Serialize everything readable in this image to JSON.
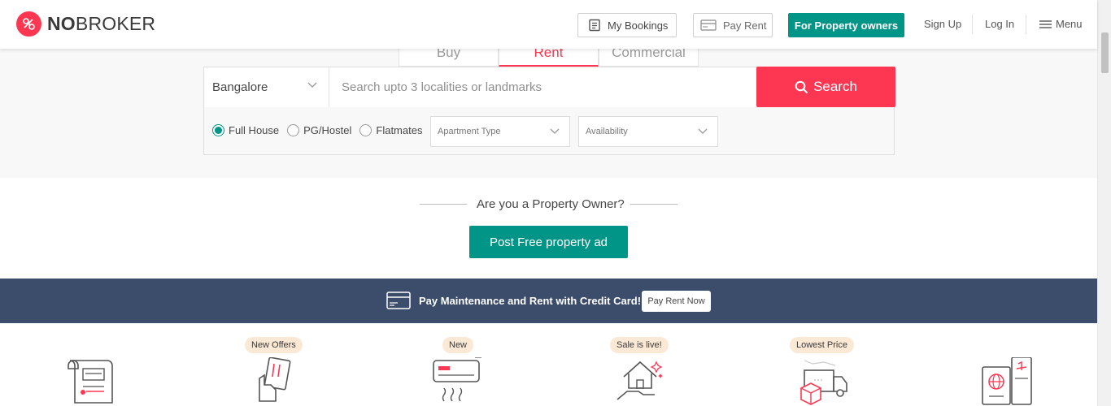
{
  "brand": {
    "name_bold": "NO",
    "name_rest": "BROKER",
    "accent_color": "#fd3752",
    "teal_color": "#009587"
  },
  "header": {
    "my_bookings": "My Bookings",
    "pay_rent": "Pay Rent",
    "for_owners": "For Property owners",
    "sign_up": "Sign Up",
    "log_in": "Log In",
    "menu": "Menu"
  },
  "search": {
    "tabs": [
      {
        "label": "Buy",
        "active": false
      },
      {
        "label": "Rent",
        "active": true
      },
      {
        "label": "Commercial",
        "active": false
      }
    ],
    "city": "Bangalore",
    "placeholder": "Search upto 3 localities or landmarks",
    "button": "Search",
    "radios": [
      {
        "label": "Full House",
        "checked": true
      },
      {
        "label": "PG/Hostel",
        "checked": false
      },
      {
        "label": "Flatmates",
        "checked": false
      }
    ],
    "apartment_type": "Apartment Type",
    "availability": "Availability"
  },
  "owner": {
    "question": "Are you a Property Owner?",
    "post_button": "Post Free property ad"
  },
  "banner": {
    "text": "Pay Maintenance and Rent with Credit Card!",
    "button": "Pay Rent Now",
    "bg_color": "#3c4d6b"
  },
  "services": {
    "badges": [
      "New Offers",
      "New",
      "Sale is live!",
      "Lowest Price"
    ],
    "icons": [
      "rental-agreement-icon",
      "pay-rent-icon",
      "ac-service-icon",
      "home-service-icon",
      "packers-movers-icon",
      "passport-icon"
    ]
  }
}
